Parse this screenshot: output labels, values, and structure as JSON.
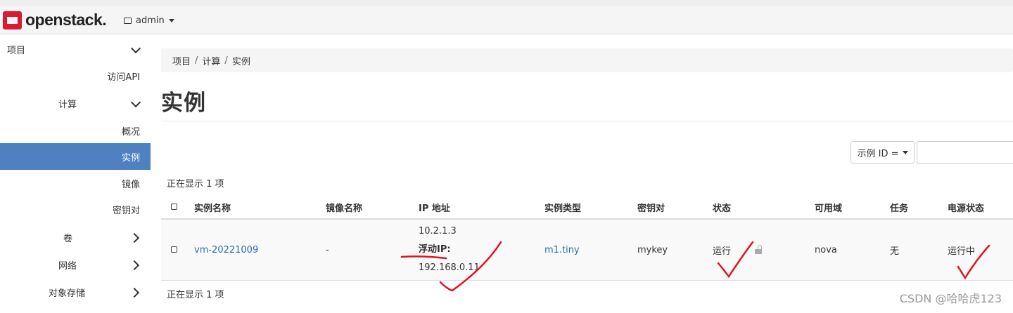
{
  "browser": {
    "bookmarks": [
      "",
      "",
      "",
      "",
      "",
      "",
      "",
      "",
      "",
      "",
      "",
      "",
      "",
      ""
    ]
  },
  "header": {
    "logo_text": "openstack.",
    "project": "admin"
  },
  "sidebar": {
    "items": [
      {
        "label": "项目"
      },
      {
        "label": "访问API"
      },
      {
        "label": "计算"
      },
      {
        "label": "概况"
      },
      {
        "label": "实例"
      },
      {
        "label": "镜像"
      },
      {
        "label": "密钥对"
      },
      {
        "label": "卷"
      },
      {
        "label": "网络"
      },
      {
        "label": "对象存储"
      }
    ]
  },
  "breadcrumb": [
    "项目",
    "计算",
    "实例"
  ],
  "page_title": "实例",
  "filter": {
    "select_label": "示例 ID =",
    "input_value": ""
  },
  "count_text": "正在显示 1 项",
  "table": {
    "headers": [
      "实例名称",
      "镜像名称",
      "IP 地址",
      "实例类型",
      "密钥对",
      "状态",
      "可用域",
      "任务",
      "电源状态"
    ],
    "rows": [
      {
        "name": "vm-20221009",
        "image": "-",
        "ip_fixed": "10.2.1.3",
        "ip_floating_label": "浮动IP:",
        "ip_floating": "192.168.0.11",
        "flavor": "m1.tiny",
        "keypair": "mykey",
        "status": "运行",
        "zone": "nova",
        "task": "无",
        "power": "运行中"
      }
    ]
  },
  "watermark": "CSDN @哈哈虎123",
  "colors": {
    "brand": "#da1a32",
    "active_nav": "#4f81c0",
    "link": "#2a6bb3",
    "annotation": "#e0141e"
  }
}
